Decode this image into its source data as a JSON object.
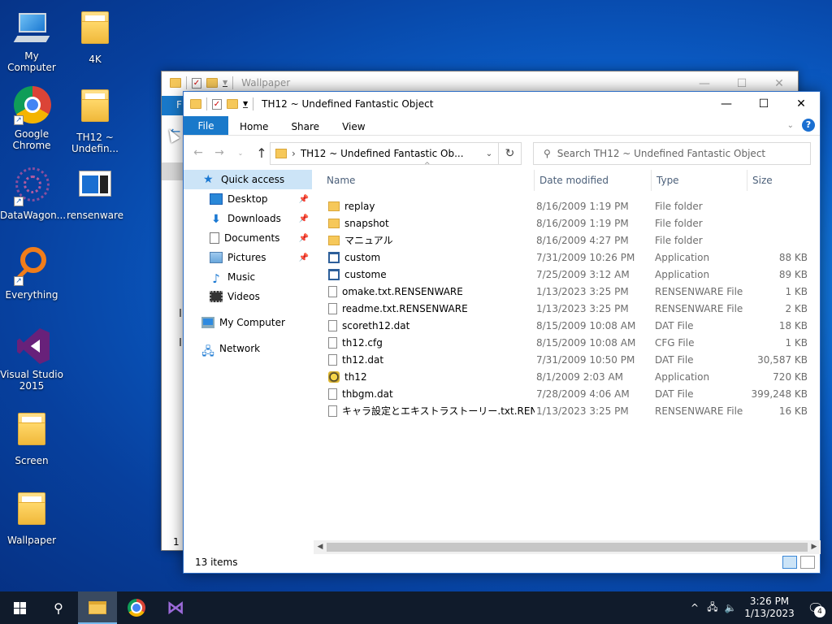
{
  "desktop": {
    "icons": [
      {
        "label": "My Computer",
        "icon": "computer-icon"
      },
      {
        "label": "4K",
        "icon": "folder-icon"
      },
      {
        "label": "Google\nChrome",
        "icon": "chrome-icon"
      },
      {
        "label": "TH12 ~\nUndefin...",
        "icon": "folder-icon"
      },
      {
        "label": "DataWagon...",
        "icon": "datawagon-icon"
      },
      {
        "label": "rensenware",
        "icon": "rensenware-icon"
      },
      {
        "label": "Everything",
        "icon": "everything-icon"
      },
      {
        "label": "Visual Studio\n2015",
        "icon": "visual-studio-icon"
      },
      {
        "label": "Screen",
        "icon": "folder-icon"
      },
      {
        "label": "Wallpaper",
        "icon": "folder-icon"
      }
    ]
  },
  "back_window": {
    "title": "Wallpaper",
    "file_tab": "F",
    "status_count": "1 i"
  },
  "window": {
    "title": "TH12 ~ Undefined Fantastic Object",
    "controls": {
      "minimize": "—",
      "maximize": "☐",
      "close": "✕"
    },
    "ribbon": {
      "file": "File",
      "tabs": [
        "Home",
        "Share",
        "View"
      ],
      "help": "?"
    },
    "address": {
      "path": "TH12 ~ Undefined Fantastic Ob...",
      "separator": "›"
    },
    "search": {
      "placeholder": "Search TH12 ~ Undefined Fantastic Object"
    },
    "nav": {
      "quick_access": "Quick access",
      "items": [
        {
          "label": "Desktop",
          "pinned": true
        },
        {
          "label": "Downloads",
          "pinned": true
        },
        {
          "label": "Documents",
          "pinned": true
        },
        {
          "label": "Pictures",
          "pinned": true
        },
        {
          "label": "Music",
          "pinned": false
        },
        {
          "label": "Videos",
          "pinned": false
        }
      ],
      "my_computer": "My Computer",
      "network": "Network"
    },
    "columns": {
      "name": "Name",
      "date": "Date modified",
      "type": "Type",
      "size": "Size"
    },
    "files": [
      {
        "name": "replay",
        "date": "8/16/2009 1:19 PM",
        "type": "File folder",
        "size": "",
        "icon": "folder"
      },
      {
        "name": "snapshot",
        "date": "8/16/2009 1:19 PM",
        "type": "File folder",
        "size": "",
        "icon": "folder"
      },
      {
        "name": "マニュアル",
        "date": "8/16/2009 4:27 PM",
        "type": "File folder",
        "size": "",
        "icon": "folder"
      },
      {
        "name": "custom",
        "date": "7/31/2009 10:26 PM",
        "type": "Application",
        "size": "88 KB",
        "icon": "app"
      },
      {
        "name": "custome",
        "date": "7/25/2009 3:12 AM",
        "type": "Application",
        "size": "89 KB",
        "icon": "app"
      },
      {
        "name": "omake.txt.RENSENWARE",
        "date": "1/13/2023 3:25 PM",
        "type": "RENSENWARE File",
        "size": "1 KB",
        "icon": "file"
      },
      {
        "name": "readme.txt.RENSENWARE",
        "date": "1/13/2023 3:25 PM",
        "type": "RENSENWARE File",
        "size": "2 KB",
        "icon": "file"
      },
      {
        "name": "scoreth12.dat",
        "date": "8/15/2009 10:08 AM",
        "type": "DAT File",
        "size": "18 KB",
        "icon": "file"
      },
      {
        "name": "th12.cfg",
        "date": "8/15/2009 10:08 AM",
        "type": "CFG File",
        "size": "1 KB",
        "icon": "file"
      },
      {
        "name": "th12.dat",
        "date": "7/31/2009 10:50 PM",
        "type": "DAT File",
        "size": "30,587 KB",
        "icon": "file"
      },
      {
        "name": "th12",
        "date": "8/1/2009 2:03 AM",
        "type": "Application",
        "size": "720 KB",
        "icon": "game"
      },
      {
        "name": "thbgm.dat",
        "date": "7/28/2009 4:06 AM",
        "type": "DAT File",
        "size": "399,248 KB",
        "icon": "file"
      },
      {
        "name": "キャラ設定とエキストラストーリー.txt.RENSEN...",
        "date": "1/13/2023 3:25 PM",
        "type": "RENSENWARE File",
        "size": "16 KB",
        "icon": "file"
      }
    ],
    "status": "13 items"
  },
  "taskbar": {
    "time": "3:26 PM",
    "date": "1/13/2023",
    "notifications": "4"
  }
}
